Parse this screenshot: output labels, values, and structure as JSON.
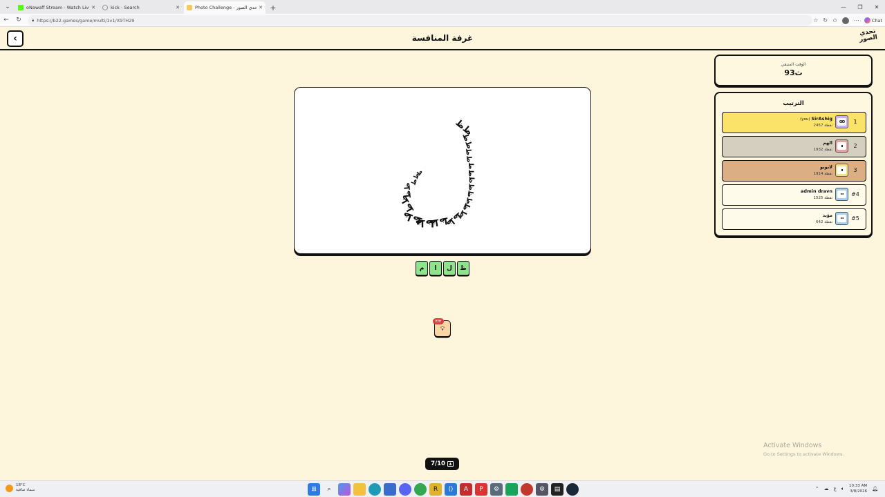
{
  "browser": {
    "tabs": [
      {
        "title": "oNawaff Stream - Watch Live on K",
        "favicon_color": "#53fc18",
        "active": false
      },
      {
        "title": "kick - Search",
        "favicon_color": "#cfcfcf",
        "active": false
      },
      {
        "title": "Photo Challenge - لعبة تحدي الصور",
        "favicon_color": "#f6c85f",
        "active": true
      }
    ],
    "url": "https://b22.games/game/multi/1v1/X9TH29",
    "chat_label": "Chat"
  },
  "header": {
    "title": "غرفة المنافسة",
    "logo_text_1": "تحدي",
    "logo_text_2": "الصور"
  },
  "timer": {
    "label": "الوقت المتبقي",
    "value": "93ث"
  },
  "ranking": {
    "title": "الترتيب",
    "players": [
      {
        "rank": "1",
        "name": "SirAshig",
        "you": "(you)",
        "points": "2457 نقطة",
        "avatar": "purple"
      },
      {
        "rank": "2",
        "name": "الهم",
        "you": "",
        "points": "1932 نقطة",
        "avatar": "red"
      },
      {
        "rank": "3",
        "name": "لابوبو",
        "you": "",
        "points": "1914 نقطة",
        "avatar": "yellow"
      },
      {
        "rank": "#4",
        "name": "admin dravn",
        "you": "",
        "points": "1525 نقطة",
        "avatar": "blue"
      },
      {
        "rank": "#5",
        "name": "مؤيد",
        "you": "",
        "points": "642 نقطة",
        "avatar": "blue"
      }
    ]
  },
  "answer_tiles": [
    "م",
    "ا",
    "ل",
    "ظ"
  ],
  "hint": {
    "badge": "٢/٢",
    "icon": "lightbulb-icon"
  },
  "round": {
    "text": "7/10",
    "icon": "image-icon"
  },
  "watermark": {
    "line1": "Activate Windows",
    "line2": "Go to Settings to activate Windows."
  },
  "taskbar": {
    "weather_temp": "18°C",
    "weather_desc": "سماء صافية",
    "time": "10:33 AM",
    "date": "3/8/2026"
  }
}
